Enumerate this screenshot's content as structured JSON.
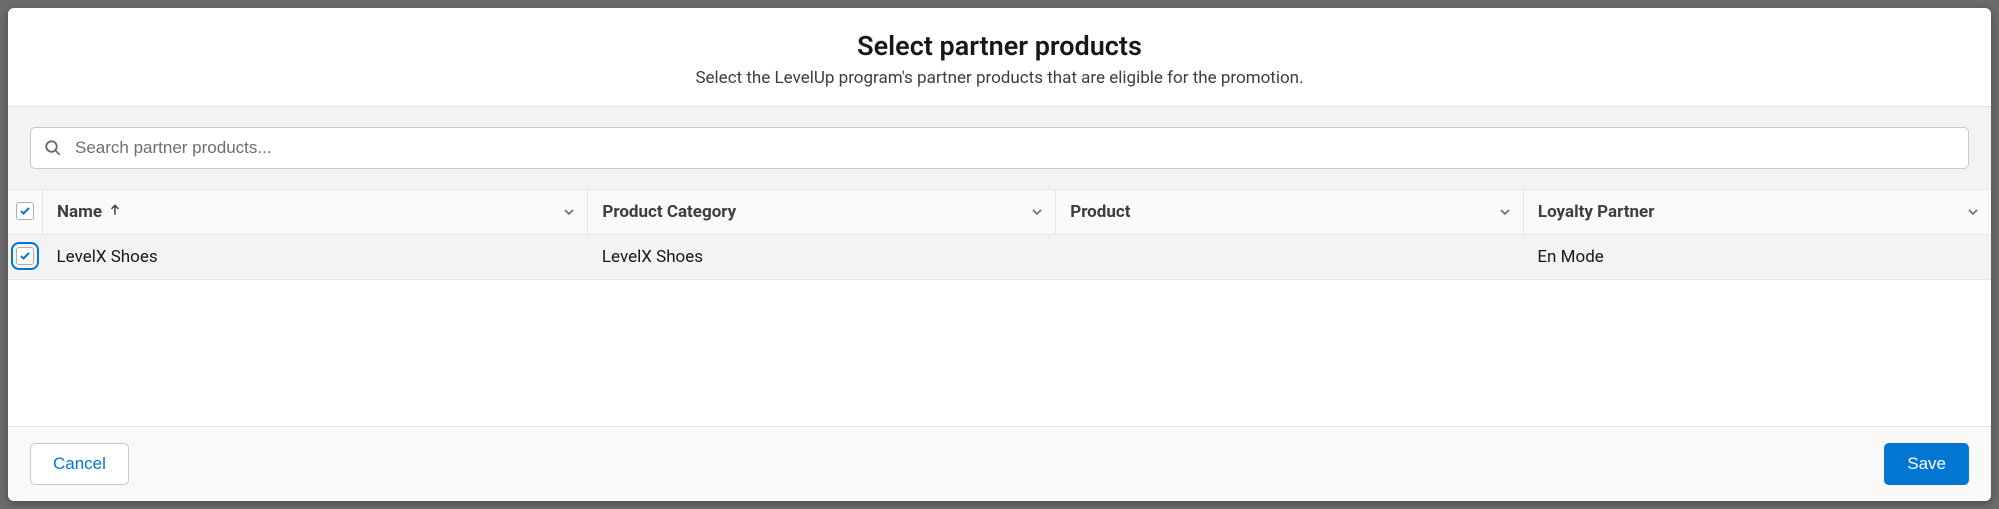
{
  "background_hint": "Select eligible partner products from loyalty program",
  "header": {
    "title": "Select partner products",
    "subtitle": "Select the LevelUp program's partner products that are eligible for the promotion."
  },
  "search": {
    "placeholder": "Search partner products..."
  },
  "table": {
    "columns": {
      "name": "Name",
      "category": "Product Category",
      "product": "Product",
      "partner": "Loyalty Partner"
    },
    "rows": [
      {
        "name": "LevelX Shoes",
        "category": "LevelX Shoes",
        "product": "",
        "partner": "En Mode",
        "selected": true
      }
    ]
  },
  "footer": {
    "cancel": "Cancel",
    "save": "Save"
  }
}
